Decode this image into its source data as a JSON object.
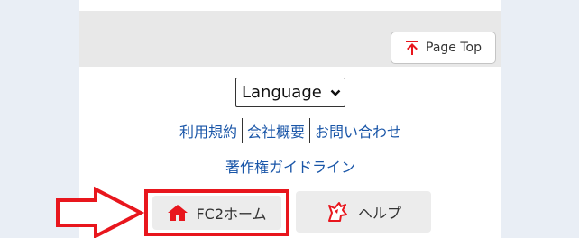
{
  "page_top_button": {
    "label": "Page Top",
    "icon": "arrow-up-to-top-icon"
  },
  "language_select": {
    "label": "Language",
    "icon": "chevron-down-icon"
  },
  "footer_links": [
    {
      "label": "利用規約"
    },
    {
      "label": "会社概要"
    },
    {
      "label": "お問い合わせ"
    }
  ],
  "guideline_link": {
    "label": "著作権ガイドライン"
  },
  "fc2_home_button": {
    "label": "FC2ホーム",
    "icon": "home-icon"
  },
  "help_button": {
    "label": "ヘルプ",
    "icon": "unicorn-icon"
  },
  "annotation": {
    "icon": "arrow-right-outline-icon",
    "color": "#e8161d"
  },
  "colors": {
    "accent": "#e8161d",
    "link": "#1a56a8"
  }
}
